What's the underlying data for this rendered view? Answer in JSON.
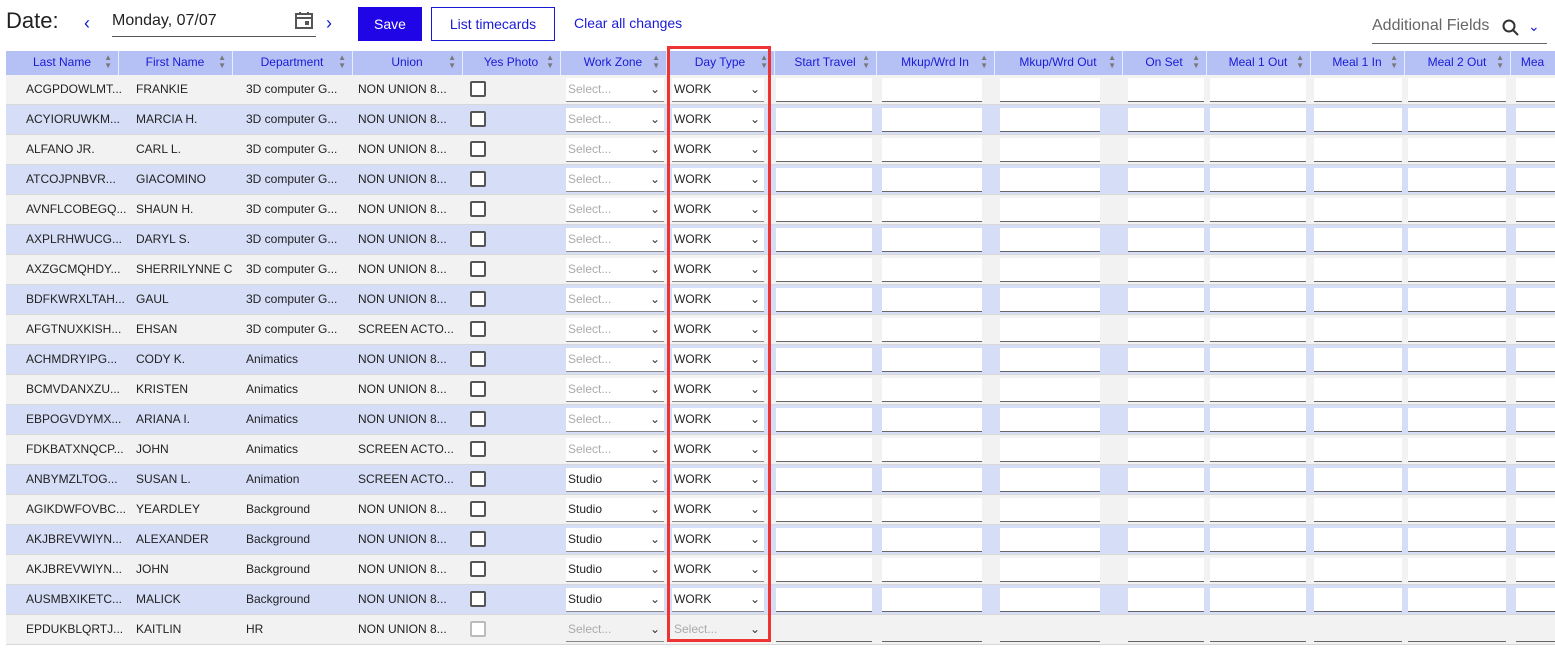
{
  "header": {
    "date_label": "Date:",
    "prev_icon": "chevron-left-icon",
    "next_icon": "chevron-right-icon",
    "date_value": "Monday, 07/07",
    "calendar_icon": "calendar-icon",
    "save_label": "Save",
    "list_label": "List timecards",
    "clear_label": "Clear all changes",
    "additional_fields_label": "Additional Fields",
    "search_icon": "search-icon",
    "dropdown_icon": "chevron-down-icon"
  },
  "columns": [
    "Last Name",
    "First Name",
    "Department",
    "Union",
    "Yes Photo",
    "Work Zone",
    "Day Type",
    "Start Travel",
    "Mkup/Wrd In",
    "Mkup/Wrd Out",
    "On Set",
    "Meal 1 Out",
    "Meal 1 In",
    "Meal 2 Out",
    "Mea"
  ],
  "select_placeholder": "Select...",
  "rows": [
    {
      "last": "ACGPDOWLMT...",
      "first": "FRANKIE",
      "dept": "3D computer G...",
      "union": "NON UNION 8...",
      "zone": "",
      "day": "WORK"
    },
    {
      "last": "ACYIORUWKM...",
      "first": "MARCIA H.",
      "dept": "3D computer G...",
      "union": "NON UNION 8...",
      "zone": "",
      "day": "WORK"
    },
    {
      "last": "ALFANO JR.",
      "first": "CARL L.",
      "dept": "3D computer G...",
      "union": "NON UNION 8...",
      "zone": "",
      "day": "WORK"
    },
    {
      "last": "ATCOJPNBVR...",
      "first": "GIACOMINO",
      "dept": "3D computer G...",
      "union": "NON UNION 8...",
      "zone": "",
      "day": "WORK"
    },
    {
      "last": "AVNFLCOBEGQ...",
      "first": "SHAUN H.",
      "dept": "3D computer G...",
      "union": "NON UNION 8...",
      "zone": "",
      "day": "WORK"
    },
    {
      "last": "AXPLRHWUCG...",
      "first": "DARYL S.",
      "dept": "3D computer G...",
      "union": "NON UNION 8...",
      "zone": "",
      "day": "WORK"
    },
    {
      "last": "AXZGCMQHDY...",
      "first": "SHERRILYNNE C",
      "dept": "3D computer G...",
      "union": "NON UNION 8...",
      "zone": "",
      "day": "WORK"
    },
    {
      "last": "BDFKWRXLTAH...",
      "first": "GAUL",
      "dept": "3D computer G...",
      "union": "NON UNION 8...",
      "zone": "",
      "day": "WORK"
    },
    {
      "last": "AFGTNUXKISH...",
      "first": "EHSAN",
      "dept": "3D computer G...",
      "union": "SCREEN ACTO...",
      "zone": "",
      "day": "WORK"
    },
    {
      "last": "ACHMDRYIPG...",
      "first": "CODY K.",
      "dept": "Animatics",
      "union": "NON UNION 8...",
      "zone": "",
      "day": "WORK"
    },
    {
      "last": "BCMVDANXZU...",
      "first": "KRISTEN",
      "dept": "Animatics",
      "union": "NON UNION 8...",
      "zone": "",
      "day": "WORK"
    },
    {
      "last": "EBPOGVDYMX...",
      "first": "ARIANA I.",
      "dept": "Animatics",
      "union": "NON UNION 8...",
      "zone": "",
      "day": "WORK"
    },
    {
      "last": "FDKBATXNQCP...",
      "first": "JOHN",
      "dept": "Animatics",
      "union": "SCREEN ACTO...",
      "zone": "",
      "day": "WORK"
    },
    {
      "last": "ANBYMZLTOG...",
      "first": "SUSAN L.",
      "dept": "Animation",
      "union": "SCREEN ACTO...",
      "zone": "Studio",
      "day": "WORK"
    },
    {
      "last": "AGIKDWFOVBC...",
      "first": "YEARDLEY",
      "dept": "Background",
      "union": "NON UNION 8...",
      "zone": "Studio",
      "day": "WORK"
    },
    {
      "last": "AKJBREVWIYN...",
      "first": "ALEXANDER",
      "dept": "Background",
      "union": "NON UNION 8...",
      "zone": "Studio",
      "day": "WORK"
    },
    {
      "last": "AKJBREVWIYN...",
      "first": "JOHN",
      "dept": "Background",
      "union": "NON UNION 8...",
      "zone": "Studio",
      "day": "WORK"
    },
    {
      "last": "AUSMBXIKETC...",
      "first": "MALICK",
      "dept": "Background",
      "union": "NON UNION 8...",
      "zone": "Studio",
      "day": "WORK"
    },
    {
      "last": "EPDUKBLQRTJ...",
      "first": "KAITLIN",
      "dept": "HR",
      "union": "NON UNION 8...",
      "zone": "",
      "day": "",
      "disabled": true
    }
  ],
  "colors": {
    "accent": "#2006e6",
    "header_bg": "#b5c0f5",
    "row_alt": "#d6ddf7",
    "highlight": "#e33333"
  }
}
